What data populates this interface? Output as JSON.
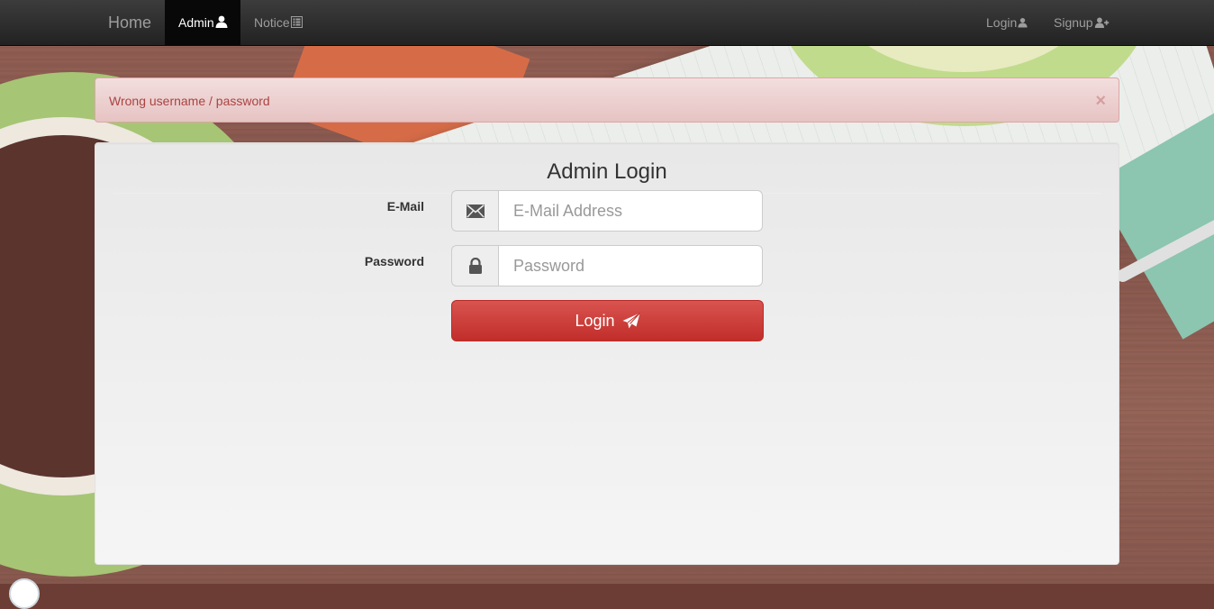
{
  "navbar": {
    "brand": "Home",
    "items": [
      {
        "label": "Admin",
        "active": true,
        "icon": "user-icon"
      },
      {
        "label": "Notice",
        "active": false,
        "icon": "list-icon"
      }
    ],
    "right_items": [
      {
        "label": "Login",
        "icon": "user-icon"
      },
      {
        "label": "Signup",
        "icon": "add-user-icon"
      }
    ]
  },
  "alert": {
    "message": "Wrong username / password",
    "close": "×"
  },
  "login_form": {
    "title": "Admin Login",
    "email_label": "E-Mail",
    "email_placeholder": "E-Mail Address",
    "email_icon": "envelope-icon",
    "password_label": "Password",
    "password_placeholder": "Password",
    "password_icon": "lock-icon",
    "submit_label": "Login",
    "submit_icon": "send-icon"
  },
  "colors": {
    "navbar": "#222222",
    "alert_bg": "#f2dede",
    "alert_text": "#a94442",
    "button": "#d9534f"
  }
}
